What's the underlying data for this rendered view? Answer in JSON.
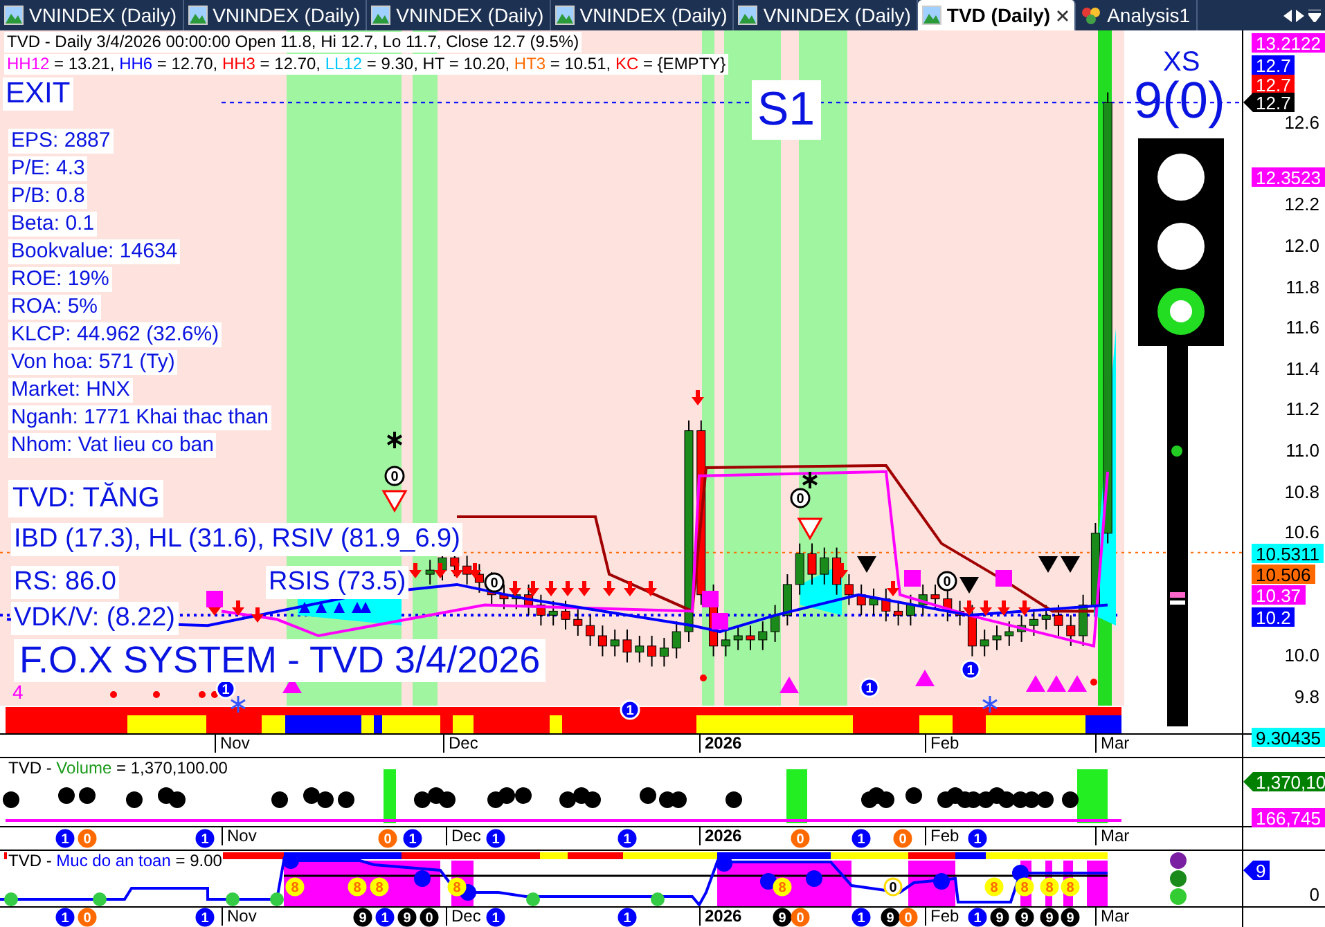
{
  "tabs": [
    {
      "label": "VNINDEX (Daily)",
      "kind": "chart",
      "selected": false,
      "closable": false
    },
    {
      "label": "VNINDEX (Daily)",
      "kind": "chart",
      "selected": false,
      "closable": false
    },
    {
      "label": "VNINDEX (Daily)",
      "kind": "chart",
      "selected": false,
      "closable": false
    },
    {
      "label": "VNINDEX (Daily)",
      "kind": "chart",
      "selected": false,
      "closable": false
    },
    {
      "label": "VNINDEX (Daily)",
      "kind": "chart",
      "selected": false,
      "closable": false
    },
    {
      "label": "TVD (Daily)",
      "kind": "chart",
      "selected": true,
      "closable": true
    },
    {
      "label": "Analysis1",
      "kind": "analysis",
      "selected": false,
      "closable": false
    }
  ],
  "price_chart": {
    "header": "TVD - Daily 3/4/2026 00:00:00 Open 11.8, Hi 12.7, Lo 11.7, Close 12.7 (9.5%)",
    "readouts": [
      {
        "label": "HH12",
        "value": " = 13.21, ",
        "color": "#ff00ff"
      },
      {
        "label": "HH6",
        "value": " = 12.70, ",
        "color": "#0000ff"
      },
      {
        "label": "HH3",
        "value": " = 12.70, ",
        "color": "#ff0000"
      },
      {
        "label": "LL12",
        "value": " = 9.30, ",
        "color": "#00c8ff"
      },
      {
        "label": "HT",
        "value": "  = 10.20, ",
        "color": "#000000"
      },
      {
        "label": "HT3",
        "value": "  = 10.51, ",
        "color": "#ff6a00"
      },
      {
        "label": "KC",
        "value": " = {EMPTY}",
        "color": "#ff0000"
      }
    ],
    "exit_label": "EXIT",
    "signal_label": "S1",
    "rating_label": "XS",
    "rating_value": "9(0)",
    "fundamentals": [
      "EPS: 2887",
      "P/E: 4.3",
      "P/B: 0.8",
      "Beta: 0.1",
      "Bookvalue: 14634",
      "ROE: 19%",
      "ROA: 5%",
      "KLCP: 44.962 (32.6%)",
      "Von hoa: 571 (Ty)",
      "Market: HNX",
      "Nganh: 1771 Khai thac than",
      "Nhom: Vat lieu co ban"
    ],
    "trend": "TVD: TĂNG",
    "strength": "IBD (17.3), HL (31.6), RSIV (81.9_6.9)",
    "rs": "RS: 86.0",
    "rsis": "RSIS (73.5)",
    "vdk": "VDK/V:  (8.22)",
    "banner": "F.O.X SYSTEM - TVD 3/4/2026",
    "count": "4",
    "markers": [
      {
        "text": "0",
        "kind": "ring"
      },
      {
        "text": "0",
        "kind": "ring"
      },
      {
        "text": "0",
        "kind": "ring"
      },
      {
        "text": "0",
        "kind": "ring"
      },
      {
        "text": "1",
        "kind": "disc"
      },
      {
        "text": "1",
        "kind": "disc"
      },
      {
        "text": "1",
        "kind": "disc"
      },
      {
        "text": "1",
        "kind": "disc"
      }
    ],
    "y_ticks": [
      "12.6",
      "12.2",
      "12.0",
      "11.8",
      "11.6",
      "11.4",
      "11.2",
      "11.0",
      "10.8",
      "10.6",
      "10.0",
      "9.8"
    ],
    "axis_tags": [
      {
        "text": "13.2122",
        "color": "#ff00ff",
        "kind": "level"
      },
      {
        "text": "12.7",
        "color": "#0000ff",
        "kind": "level"
      },
      {
        "text": "12.7",
        "color": "#ff0000",
        "kind": "level"
      },
      {
        "text": "12.7",
        "color": "#000000",
        "kind": "current"
      },
      {
        "text": "12.3523",
        "color": "#ff00ff",
        "kind": "level"
      },
      {
        "text": "10.5311",
        "color": "#00ffff",
        "kind": "level"
      },
      {
        "text": "10.506",
        "color": "#ff6a00",
        "kind": "level"
      },
      {
        "text": "10.37",
        "color": "#ff00ff",
        "kind": "level"
      },
      {
        "text": "10.2",
        "color": "#0000ff",
        "kind": "level"
      },
      {
        "text": "9.30435",
        "color": "#00ffff",
        "kind": "level"
      }
    ]
  },
  "month_axis": {
    "months": [
      {
        "label": "Nov",
        "kind": "month"
      },
      {
        "label": "Dec",
        "kind": "month"
      },
      {
        "label": "2026",
        "kind": "year"
      },
      {
        "label": "Feb",
        "kind": "month"
      },
      {
        "label": "Mar",
        "kind": "month"
      }
    ]
  },
  "volume_pane": {
    "series": "TVD - ",
    "name": "Volume",
    "value": " = 1,370,100.00",
    "tags": [
      {
        "text": "1,370,10",
        "color": "#008000",
        "kind": "current"
      },
      {
        "text": "166,745",
        "color": "#ff00ff",
        "kind": "level"
      }
    ]
  },
  "volume_axis": {
    "months": [
      {
        "label": "Nov",
        "kind": "month"
      },
      {
        "label": "Dec",
        "kind": "month"
      },
      {
        "label": "2026",
        "kind": "year"
      },
      {
        "label": "Feb",
        "kind": "month"
      },
      {
        "label": "Mar",
        "kind": "month"
      }
    ],
    "markers": [
      {
        "text": "1",
        "color": "#0000ff"
      },
      {
        "text": "0",
        "color": "#ff6a00"
      },
      {
        "text": "1",
        "color": "#0000ff"
      },
      {
        "text": "0",
        "color": "#ff6a00"
      },
      {
        "text": "1",
        "color": "#0000ff"
      },
      {
        "text": "1",
        "color": "#0000ff"
      },
      {
        "text": "1",
        "color": "#0000ff"
      },
      {
        "text": "0",
        "color": "#ff6a00"
      },
      {
        "text": "1",
        "color": "#0000ff"
      },
      {
        "text": "0",
        "color": "#ff6a00"
      },
      {
        "text": "1",
        "color": "#0000ff"
      }
    ]
  },
  "safety_pane": {
    "series": "TVD - ",
    "name": "Muc do an toan",
    "value": " = 9.00",
    "markers": [
      {
        "text": "8",
        "kind": "disc"
      },
      {
        "text": "8",
        "kind": "disc"
      },
      {
        "text": "8",
        "kind": "disc"
      },
      {
        "text": "8",
        "kind": "disc"
      },
      {
        "text": "8",
        "kind": "disc"
      },
      {
        "text": "0",
        "kind": "ring"
      },
      {
        "text": "8",
        "kind": "disc"
      },
      {
        "text": "8",
        "kind": "disc"
      },
      {
        "text": "8",
        "kind": "disc"
      },
      {
        "text": "8",
        "kind": "disc"
      }
    ],
    "tags": [
      {
        "text": "9",
        "color": "#0000ff",
        "kind": "current"
      }
    ],
    "y_ticks": [
      "0"
    ],
    "status_dots": [
      {
        "color": "#7b1fa2"
      },
      {
        "color": "#1a8a1a"
      },
      {
        "color": "#33cc33"
      }
    ]
  },
  "safety_axis": {
    "months": [
      {
        "label": "Nov",
        "kind": "month"
      },
      {
        "label": "Dec",
        "kind": "month"
      },
      {
        "label": "2026",
        "kind": "year"
      },
      {
        "label": "Feb",
        "kind": "month"
      },
      {
        "label": "Mar",
        "kind": "month"
      }
    ],
    "markers": [
      {
        "text": "1",
        "color": "#0000ff"
      },
      {
        "text": "0",
        "color": "#ff6a00"
      },
      {
        "text": "1",
        "color": "#0000ff"
      },
      {
        "text": "9",
        "color": "#000000"
      },
      {
        "text": "1",
        "color": "#0000ff"
      },
      {
        "text": "9",
        "color": "#000000"
      },
      {
        "text": "0",
        "color": "#000000"
      },
      {
        "text": "1",
        "color": "#0000ff"
      },
      {
        "text": "1",
        "color": "#0000ff"
      },
      {
        "text": "9",
        "color": "#000000"
      },
      {
        "text": "0",
        "color": "#ff6a00"
      },
      {
        "text": "1",
        "color": "#0000ff"
      },
      {
        "text": "9",
        "color": "#000000"
      },
      {
        "text": "0",
        "color": "#ff6a00"
      },
      {
        "text": "1",
        "color": "#0000ff"
      },
      {
        "text": "9",
        "color": "#000000"
      },
      {
        "text": "9",
        "color": "#000000"
      },
      {
        "text": "9",
        "color": "#000000"
      },
      {
        "text": "9",
        "color": "#000000"
      }
    ]
  }
}
